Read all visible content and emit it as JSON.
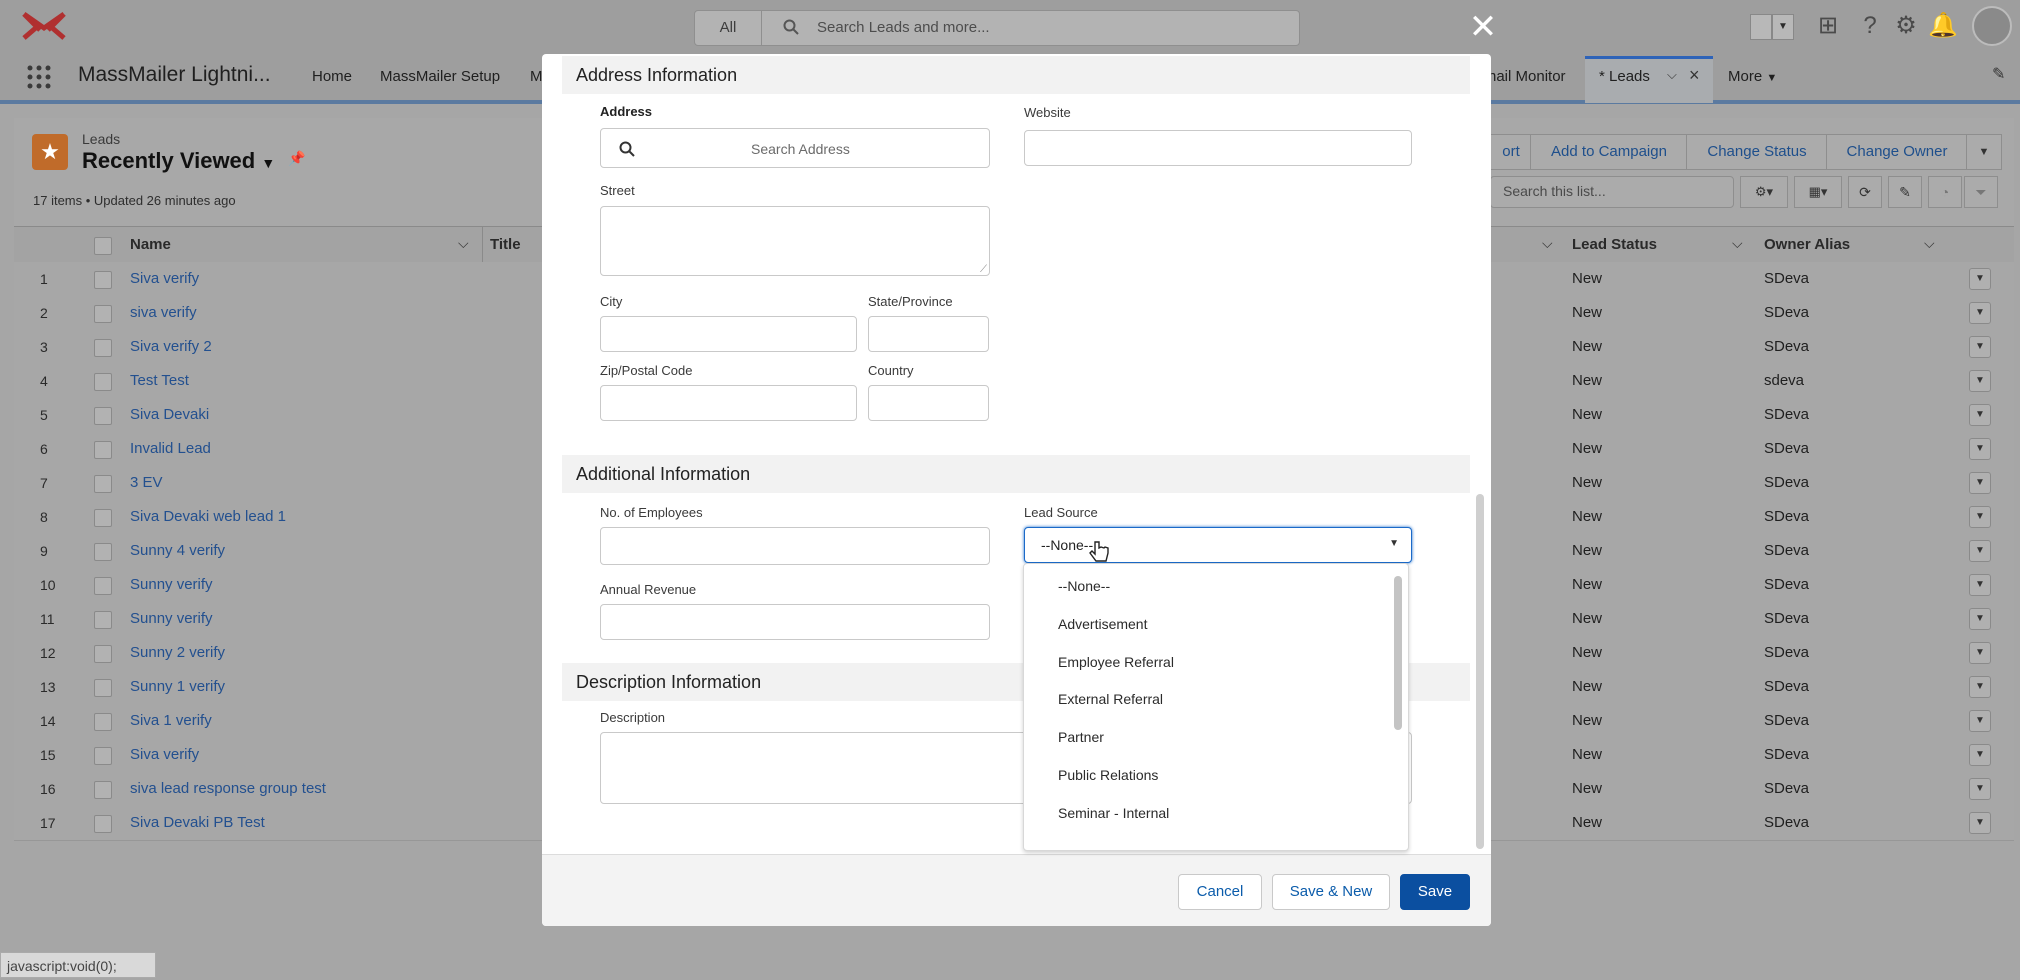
{
  "header": {
    "search_scope": "All",
    "search_placeholder": "Search Leads and more...",
    "icons": [
      "mail-logo-icon",
      "waffle-icon",
      "add-icon",
      "help-icon",
      "gear-icon",
      "bell-icon",
      "avatar"
    ]
  },
  "nav": {
    "app_name": "MassMailer Lightni...",
    "items": [
      "Home",
      "MassMailer Setup",
      "M"
    ],
    "email_monitor": "nail Monitor",
    "active_tab": "* Leads",
    "more": "More"
  },
  "listview": {
    "object_label": "Leads",
    "view_name": "Recently Viewed",
    "item_count": "17 items • Updated 26 minutes ago",
    "buttons": [
      "ort",
      "Add to Campaign",
      "Change Status",
      "Change Owner"
    ],
    "search_placeholder": "Search this list...",
    "columns": {
      "name": "Name",
      "title": "Title",
      "lead_status": "Lead Status",
      "owner_alias": "Owner Alias"
    },
    "rows": [
      {
        "n": "1",
        "name": "Siva verify",
        "status": "New",
        "owner": "SDeva"
      },
      {
        "n": "2",
        "name": "siva verify",
        "status": "New",
        "owner": "SDeva"
      },
      {
        "n": "3",
        "name": "Siva verify 2",
        "status": "New",
        "owner": "SDeva"
      },
      {
        "n": "4",
        "name": "Test Test",
        "status": "New",
        "owner": "sdeva"
      },
      {
        "n": "5",
        "name": "Siva Devaki",
        "status": "New",
        "owner": "SDeva"
      },
      {
        "n": "6",
        "name": "Invalid Lead",
        "status": "New",
        "owner": "SDeva"
      },
      {
        "n": "7",
        "name": "3 EV",
        "status": "New",
        "owner": "SDeva"
      },
      {
        "n": "8",
        "name": "Siva Devaki web lead 1",
        "status": "New",
        "owner": "SDeva"
      },
      {
        "n": "9",
        "name": "Sunny 4 verify",
        "status": "New",
        "owner": "SDeva"
      },
      {
        "n": "10",
        "name": "Sunny verify",
        "status": "New",
        "owner": "SDeva"
      },
      {
        "n": "11",
        "name": "Sunny verify",
        "status": "New",
        "owner": "SDeva"
      },
      {
        "n": "12",
        "name": "Sunny 2 verify",
        "status": "New",
        "owner": "SDeva"
      },
      {
        "n": "13",
        "name": "Sunny 1 verify",
        "status": "New",
        "owner": "SDeva"
      },
      {
        "n": "14",
        "name": "Siva 1 verify",
        "status": "New",
        "owner": "SDeva"
      },
      {
        "n": "15",
        "name": "Siva verify",
        "status": "New",
        "owner": "SDeva"
      },
      {
        "n": "16",
        "name": "siva lead response group test",
        "status": "New",
        "owner": "SDeva"
      },
      {
        "n": "17",
        "name": "Siva Devaki PB Test",
        "status": "New",
        "owner": "SDeva"
      }
    ]
  },
  "modal": {
    "address_section": "Address Information",
    "address_label": "Address",
    "search_address": "Search Address",
    "website_label": "Website",
    "street_label": "Street",
    "city_label": "City",
    "state_label": "State/Province",
    "zip_label": "Zip/Postal Code",
    "country_label": "Country",
    "additional_section": "Additional Information",
    "employees_label": "No. of Employees",
    "lead_source_label": "Lead Source",
    "lead_source_value": "--None--",
    "annual_revenue_label": "Annual Revenue",
    "description_section": "Description Information",
    "description_label": "Description",
    "lead_source_options": [
      "--None--",
      "Advertisement",
      "Employee Referral",
      "External Referral",
      "Partner",
      "Public Relations",
      "Seminar - Internal"
    ],
    "cancel": "Cancel",
    "save_new": "Save & New",
    "save": "Save"
  },
  "status_bar": "javascript:void(0);",
  "colors": {
    "brand_blue": "#0b4fa0",
    "link_blue": "#23508f",
    "leads_orange": "#c06b2a"
  }
}
